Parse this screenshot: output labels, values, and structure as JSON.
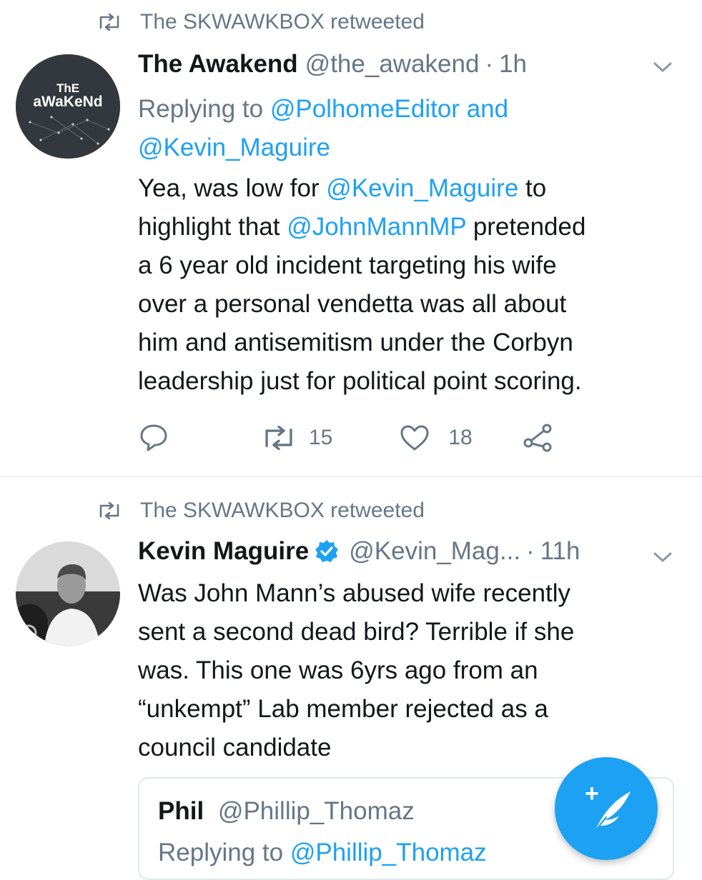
{
  "tweets": [
    {
      "retweeted_by": "The SKWAWKBOX retweeted",
      "name": "The Awakend",
      "handle": "@the_awakend",
      "sep": "·",
      "time": "1h",
      "avatar_text_top": "ThE",
      "avatar_text_bottom": "aWaKeNd",
      "replying_prefix": "Replying to",
      "replying_user1": "@PolhomeEditor",
      "replying_and": "and",
      "replying_user2": "@Kevin_Maguire",
      "body": {
        "p1": "Yea, was low for",
        "m1": "@Kevin_Maguire",
        "p2": "to",
        "p3": "highlight that",
        "m2": "@JohnMannMP",
        "p4": "pretended",
        "line3": "a 6 year old incident targeting his wife",
        "line4": "over a personal vendetta was all about",
        "line5": "him and antisemitism under the Corbyn",
        "line6": "leadership just for political point scoring."
      },
      "retweet_count": "15",
      "like_count": "18"
    },
    {
      "retweeted_by": "The SKWAWKBOX retweeted",
      "name": "Kevin Maguire",
      "handle": "@Kevin_Mag...",
      "sep": "·",
      "time": "11h",
      "body": {
        "line1": "Was John Mann’s abused wife recently",
        "line2": "sent a second dead bird? Terrible if she",
        "line3": "was. This one was 6yrs ago from an",
        "line4": "“unkempt” Lab member rejected as a",
        "line5": "council candidate"
      }
    }
  ],
  "quoted_tweet": {
    "name": "Phil",
    "handle": "@Phillip_Thomaz",
    "replying_prefix": "Replying to",
    "replying_user": "@Phillip_Thomaz"
  },
  "fab": {
    "plus": "+",
    "icon": "compose-tweet-icon"
  },
  "colors": {
    "accent": "#1da1f2",
    "secondary_text": "#657786",
    "divider": "#e1e8ed"
  }
}
